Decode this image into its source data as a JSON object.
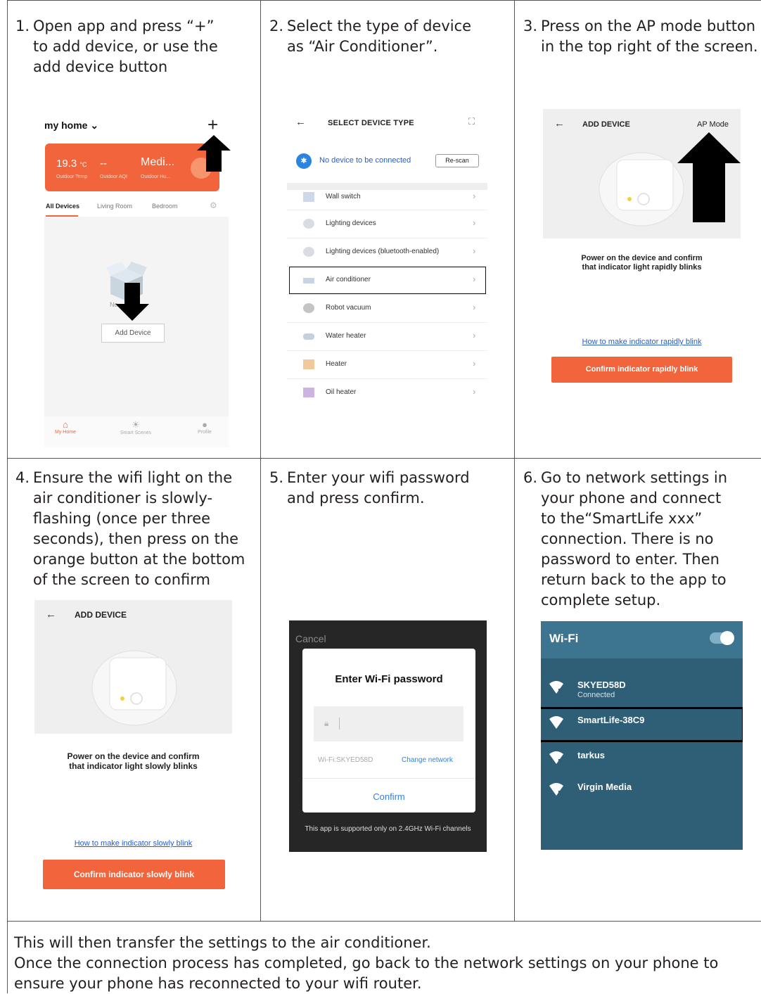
{
  "steps": [
    {
      "num": "1.",
      "lines": [
        "Open app and press “+”",
        "to add device, or use the",
        "add device button"
      ]
    },
    {
      "num": "2.",
      "lines": [
        "Select the type of device",
        "as “Air Conditioner”."
      ]
    },
    {
      "num": "3.",
      "lines": [
        "Press on the AP mode button",
        "in the top right of the screen."
      ]
    },
    {
      "num": "4.",
      "lines": [
        "Ensure the wifi light on the",
        "air conditioner is slowly-",
        "flashing (once per three",
        "seconds), then press on the",
        "orange button at the bottom",
        "of the screen to confirm"
      ]
    },
    {
      "num": "5.",
      "lines": [
        "Enter your wifi password",
        "and press confirm."
      ]
    },
    {
      "num": "6.",
      "lines": [
        "Go to network settings in",
        "your phone and connect",
        "to the“SmartLife xxx”",
        "connection. There is no",
        "password to enter. Then",
        "return back to the app to",
        "complete setup."
      ]
    }
  ],
  "footer": [
    "This will then transfer the settings to the air conditioner.",
    "Once the connection process has completed, go back to the network settings on your phone to",
    "ensure your phone has reconnected to your wifi router."
  ],
  "screen1": {
    "title": "my home ⌄",
    "plus": "+",
    "temp": "19.3",
    "temp_unit": "°C",
    "aqi": "--",
    "humidity": "Medi...",
    "sub_temp": "Outdoor Temp",
    "sub_aqi": "Outdoor AQI",
    "sub_hum": "Outdoor Hu...",
    "tabs": [
      "All Devices",
      "Living Room",
      "Bedroom"
    ],
    "no_devices": "No ...et",
    "add_device": "Add Device",
    "nav": [
      {
        "label": "My Home",
        "icon": "home-icon"
      },
      {
        "label": "Smart Scenes",
        "icon": "sun-icon"
      },
      {
        "label": "Profile",
        "icon": "person-icon"
      }
    ]
  },
  "screen2": {
    "title": "SELECT DEVICE TYPE",
    "bt_message": "No device to be connected",
    "rescan": "Re-scan",
    "items": [
      {
        "label": "Wall switch",
        "color": "#cfd8e8"
      },
      {
        "label": "Lighting devices",
        "color": "#d9dde3"
      },
      {
        "label": "Lighting devices (bluetooth-enabled)",
        "color": "#d9dde3"
      },
      {
        "label": "Air conditioner",
        "color": "#c8d3e3"
      },
      {
        "label": "Robot vacuum",
        "color": "#c4c4c4"
      },
      {
        "label": "Water heater",
        "color": "#c4cfdf"
      },
      {
        "label": "Heater",
        "color": "#f0c99c"
      },
      {
        "label": "Oil heater",
        "color": "#cbb5e0"
      }
    ]
  },
  "screen3": {
    "title": "ADD DEVICE",
    "ap_mode": "AP Mode",
    "message_1": "Power on the device and confirm",
    "message_2": "that indicator light rapidly blinks",
    "link": "How to make indicator rapidly blink",
    "button": "Confirm indicator rapidly blink"
  },
  "screen4": {
    "title": "ADD DEVICE",
    "message_1": "Power on the device and confirm",
    "message_2": "that indicator light slowly blinks",
    "link": "How to make indicator slowly blink",
    "button": "Confirm indicator slowly blink"
  },
  "screen5": {
    "cancel": "Cancel",
    "title": "Enter Wi-Fi password",
    "wifi_name": "Wi-Fi:SKYED58D",
    "change_network": "Change network",
    "confirm": "Confirm",
    "note": "This app is supported only on 2.4GHz Wi-Fi channels"
  },
  "screen6": {
    "title": "Wi-Fi",
    "networks": [
      {
        "name": "SKYED58D",
        "status": "Connected",
        "secured": true
      },
      {
        "name": "SmartLife-38C9",
        "status": "",
        "secured": false
      },
      {
        "name": "tarkus",
        "status": "",
        "secured": true
      },
      {
        "name": "Virgin Media",
        "status": "",
        "secured": true
      }
    ]
  },
  "colors": {
    "accent": "#f2643b",
    "link": "#2b5ec8",
    "wifi_bg": "#2f5f76"
  }
}
